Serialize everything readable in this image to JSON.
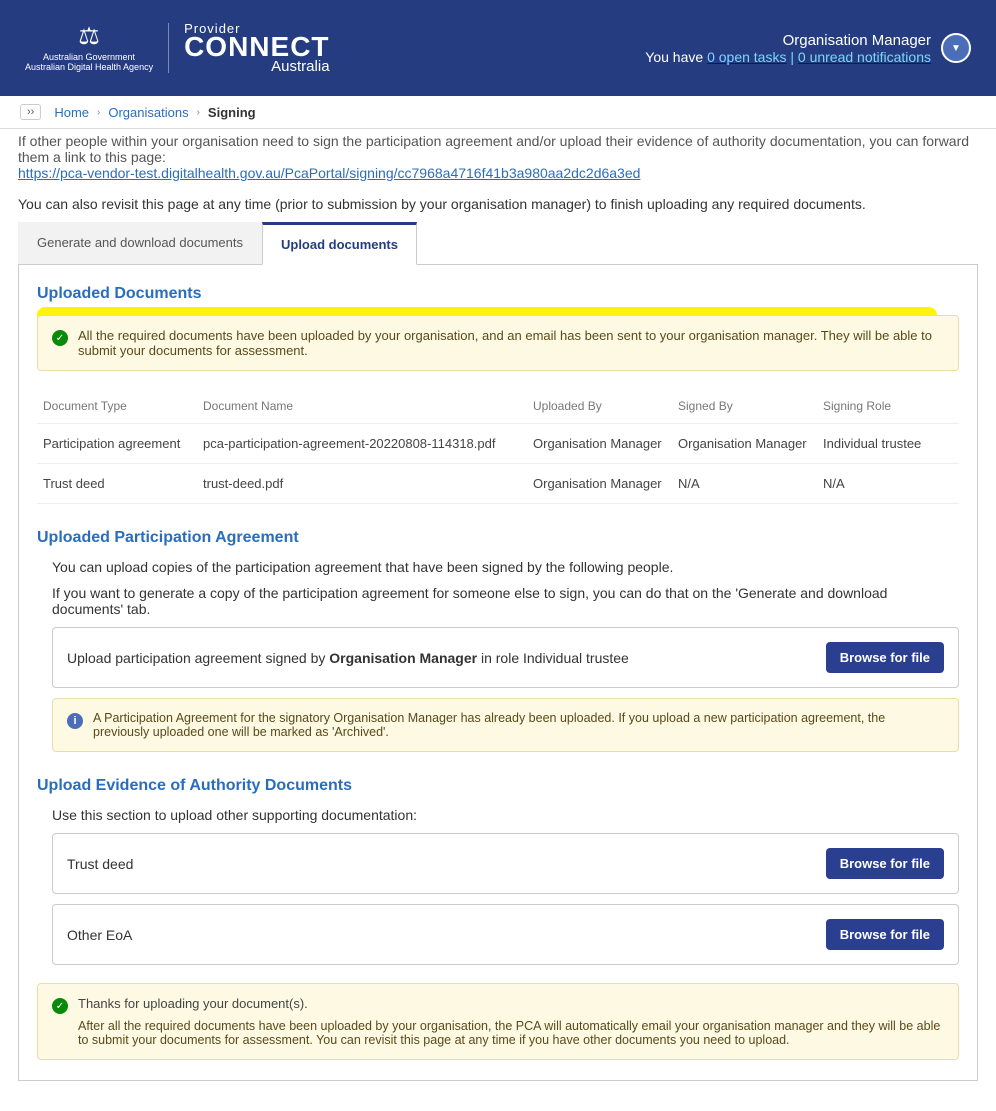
{
  "header": {
    "gov_line1": "Australian Government",
    "gov_line2": "Australian Digital Health Agency",
    "pca_line1": "Provider",
    "pca_line2": "CONNECT",
    "pca_line3": "Australia",
    "role": "Organisation Manager",
    "tasks_prefix": "You have ",
    "open_tasks_count": "0",
    "open_tasks_label": " open tasks",
    "sep": " | ",
    "notif_count": "0",
    "notif_label": " unread notifications"
  },
  "breadcrumb": {
    "expand": "››",
    "home": "Home",
    "orgs": "Organisations",
    "current": "Signing"
  },
  "intro": {
    "cutoff": "If other people within your organisation need to sign the participation agreement and/or upload their evidence of authority documentation, you can forward them a link to this page:",
    "link": "https://pca-vendor-test.digitalhealth.gov.au/PcaPortal/signing/cc7968a4716f41b3a980aa2dc2d6a3ed",
    "revisit": "You can also revisit this page at any time (prior to submission by your organisation manager) to finish uploading any required documents."
  },
  "tabs": {
    "generate": "Generate and download documents",
    "upload": "Upload documents"
  },
  "uploaded": {
    "title": "Uploaded Documents",
    "success_msg": "All the required documents have been uploaded by your organisation, and an email has been sent to your organisation manager. They will be able to submit your documents for assessment.",
    "headers": {
      "type": "Document Type",
      "name": "Document Name",
      "uploaded_by": "Uploaded By",
      "signed_by": "Signed By",
      "role": "Signing Role"
    },
    "rows": [
      {
        "type": "Participation agreement",
        "name": "pca-participation-agreement-20220808-114318.pdf",
        "uploaded_by": "Organisation Manager",
        "signed_by": "Organisation Manager",
        "role": "Individual trustee"
      },
      {
        "type": "Trust deed",
        "name": "trust-deed.pdf",
        "uploaded_by": "Organisation Manager",
        "signed_by": "N/A",
        "role": "N/A"
      }
    ]
  },
  "pa_section": {
    "title": "Uploaded Participation Agreement",
    "desc1": "You can upload copies of the participation agreement that have been signed by the following people.",
    "desc2": "If you want to generate a copy of the participation agreement for someone else to sign, you can do that on the 'Generate and download documents' tab.",
    "upload_prefix": "Upload participation agreement signed by ",
    "upload_strong": "Organisation Manager",
    "upload_suffix": " in role Individual trustee",
    "browse": "Browse for file",
    "info": "A Participation Agreement for the signatory Organisation Manager has already been uploaded. If you upload a new participation agreement, the previously uploaded one will be marked as 'Archived'."
  },
  "eoa_section": {
    "title": "Upload Evidence of Authority Documents",
    "desc": "Use this section to upload other supporting documentation:",
    "rows": [
      {
        "label": "Trust deed"
      },
      {
        "label": "Other EoA"
      }
    ],
    "browse": "Browse for file"
  },
  "thanks": {
    "title": "Thanks for uploading your document(s).",
    "body": "After all the required documents have been uploaded by your organisation, the PCA will automatically email your organisation manager and they will be able to submit your documents for assessment. You can revisit this page at any time if you have other documents you need to upload."
  }
}
